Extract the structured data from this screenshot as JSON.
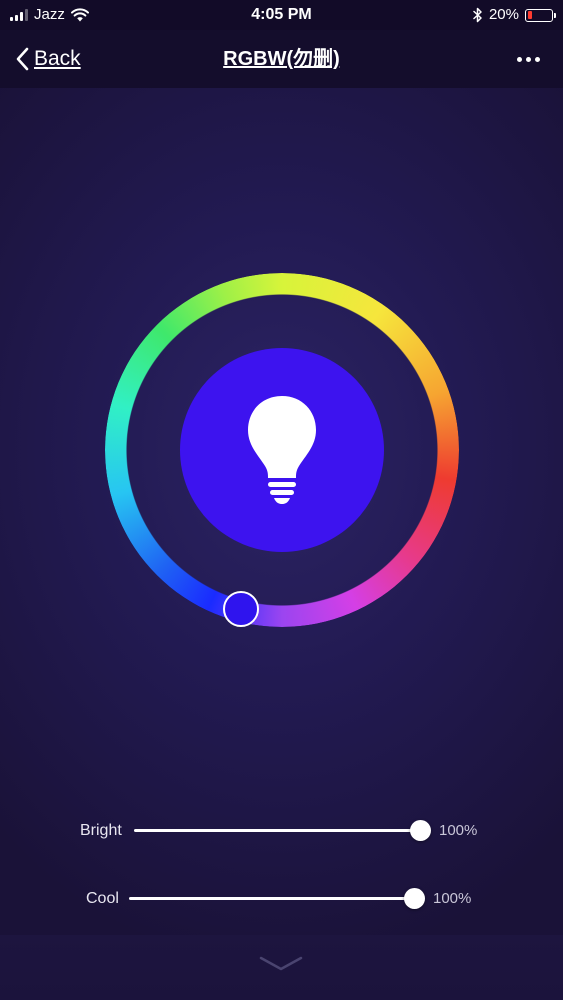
{
  "status_bar": {
    "carrier": "Jazz",
    "time": "4:05 PM",
    "battery_percent": "20%",
    "battery_level": 0.2,
    "battery_color": "#ff3b30",
    "icons": [
      "signal-icon",
      "wifi-icon",
      "bluetooth-icon",
      "battery-icon"
    ]
  },
  "nav": {
    "back_label": "Back",
    "title": "RGBW(勿删)",
    "more_icon": "more-icon"
  },
  "color_wheel": {
    "selected_color": "#3d13ef",
    "center_icon": "light-bulb-icon"
  },
  "sliders": {
    "bright": {
      "label": "Bright",
      "value_text": "100%",
      "value": 1.0
    },
    "cool": {
      "label": "Cool",
      "value_text": "100%",
      "value": 1.0
    }
  },
  "footer": {
    "icon": "chevron-down-icon"
  },
  "colors": {
    "background": "#1a1238",
    "accent": "#3d13ef",
    "text": "#ffffff"
  }
}
